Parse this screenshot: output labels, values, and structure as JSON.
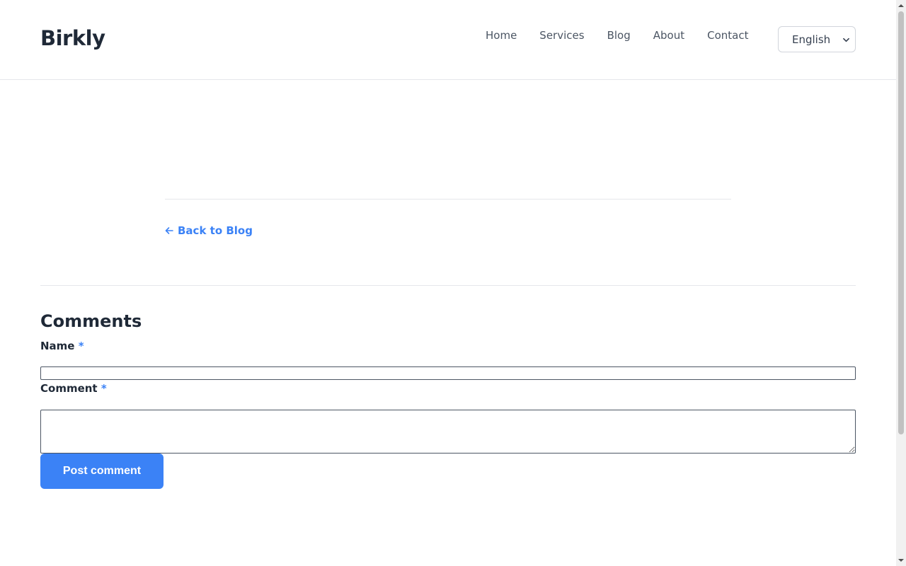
{
  "header": {
    "brand": "Birkly",
    "nav": [
      {
        "label": "Home"
      },
      {
        "label": "Services"
      },
      {
        "label": "Blog"
      },
      {
        "label": "About"
      },
      {
        "label": "Contact"
      }
    ],
    "language": {
      "selected": "English"
    }
  },
  "article": {
    "back_link": "Back to Blog"
  },
  "comments": {
    "title": "Comments",
    "name_label": "Name",
    "comment_label": "Comment",
    "required_marker": "*",
    "name_value": "",
    "comment_value": "",
    "submit_label": "Post comment"
  },
  "colors": {
    "accent": "#3b82f6",
    "text": "#1f2937",
    "muted": "#4b5563",
    "divider": "#e5e7eb"
  }
}
